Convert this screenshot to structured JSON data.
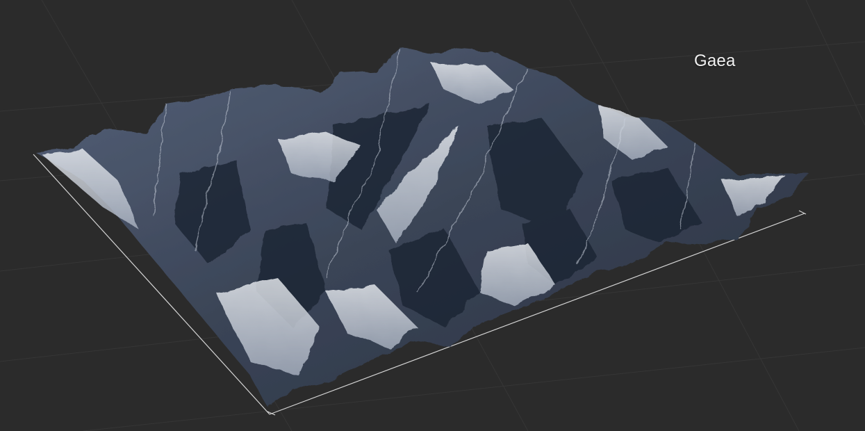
{
  "viewport": {
    "background_color": "#2b2b2b",
    "grid_color": "#3a3a3a",
    "bounds_color": "#d8d8d8"
  },
  "terrain": {
    "base_color": "#3a4456",
    "shadow_color": "#1e2532",
    "snow_color": "#d9dde3"
  },
  "overlay": {
    "title": "Gaea"
  }
}
